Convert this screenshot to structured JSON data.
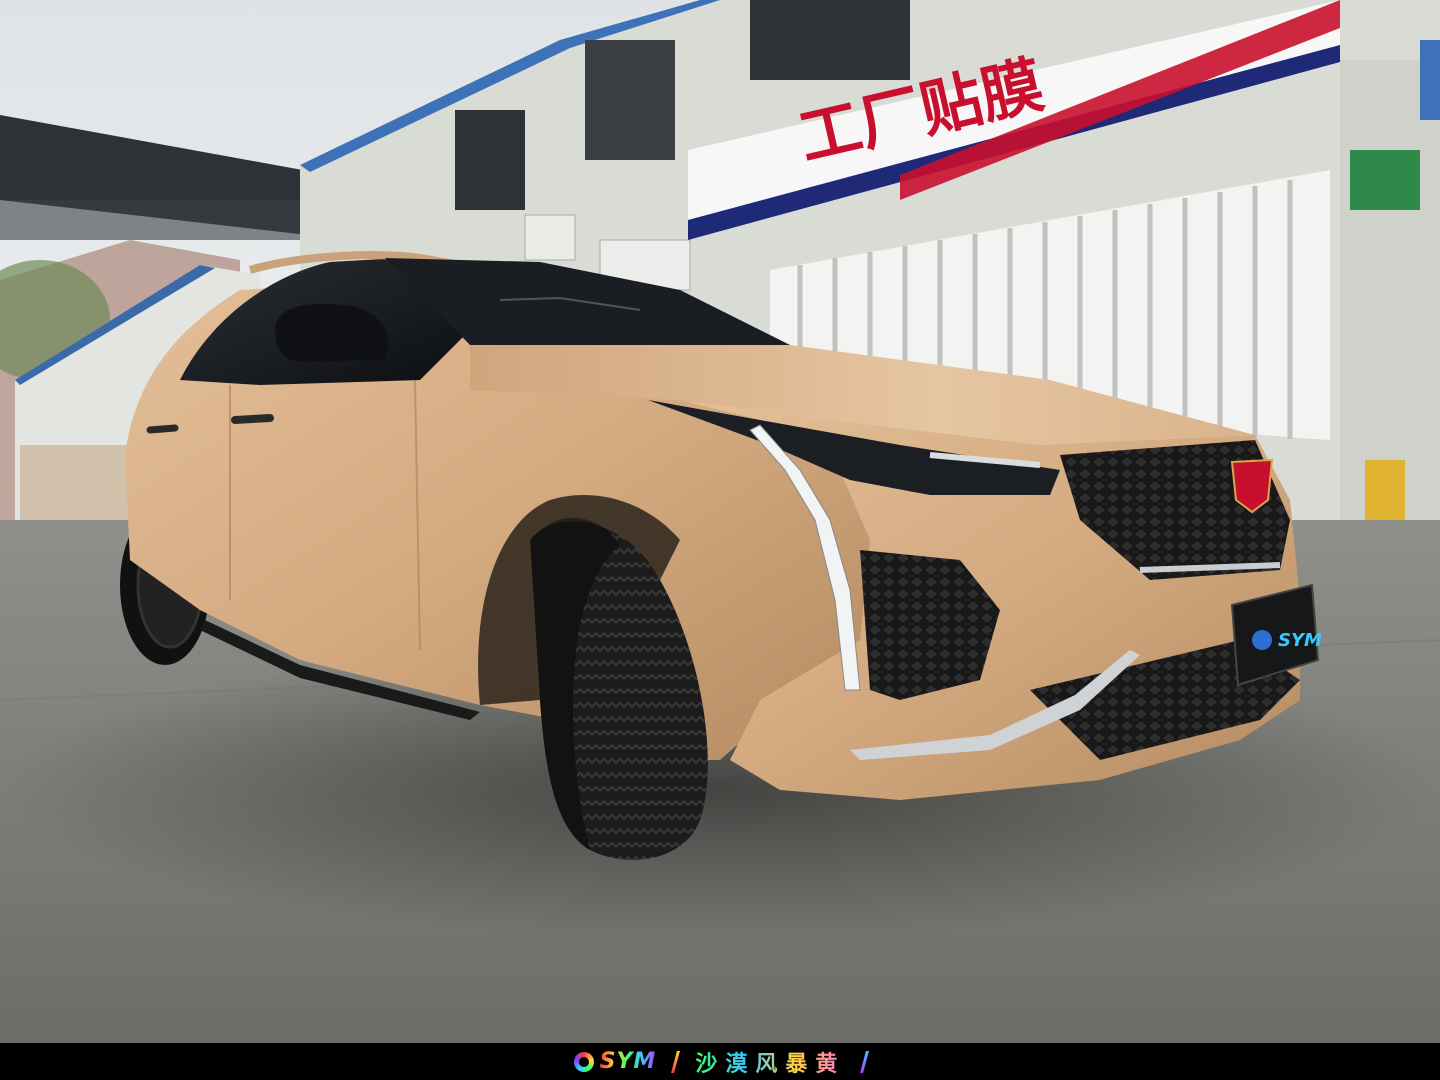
{
  "sign": {
    "text": "工厂贴膜"
  },
  "plate": {
    "brand": "SYM"
  },
  "caption": {
    "brand": "SYM",
    "title": "沙漠风暴黄"
  },
  "colors": {
    "car_paint": "#d4aa80",
    "sign_red": "#c8102e",
    "sign_blue": "#1e2a78",
    "building": "#d9dcd4"
  }
}
